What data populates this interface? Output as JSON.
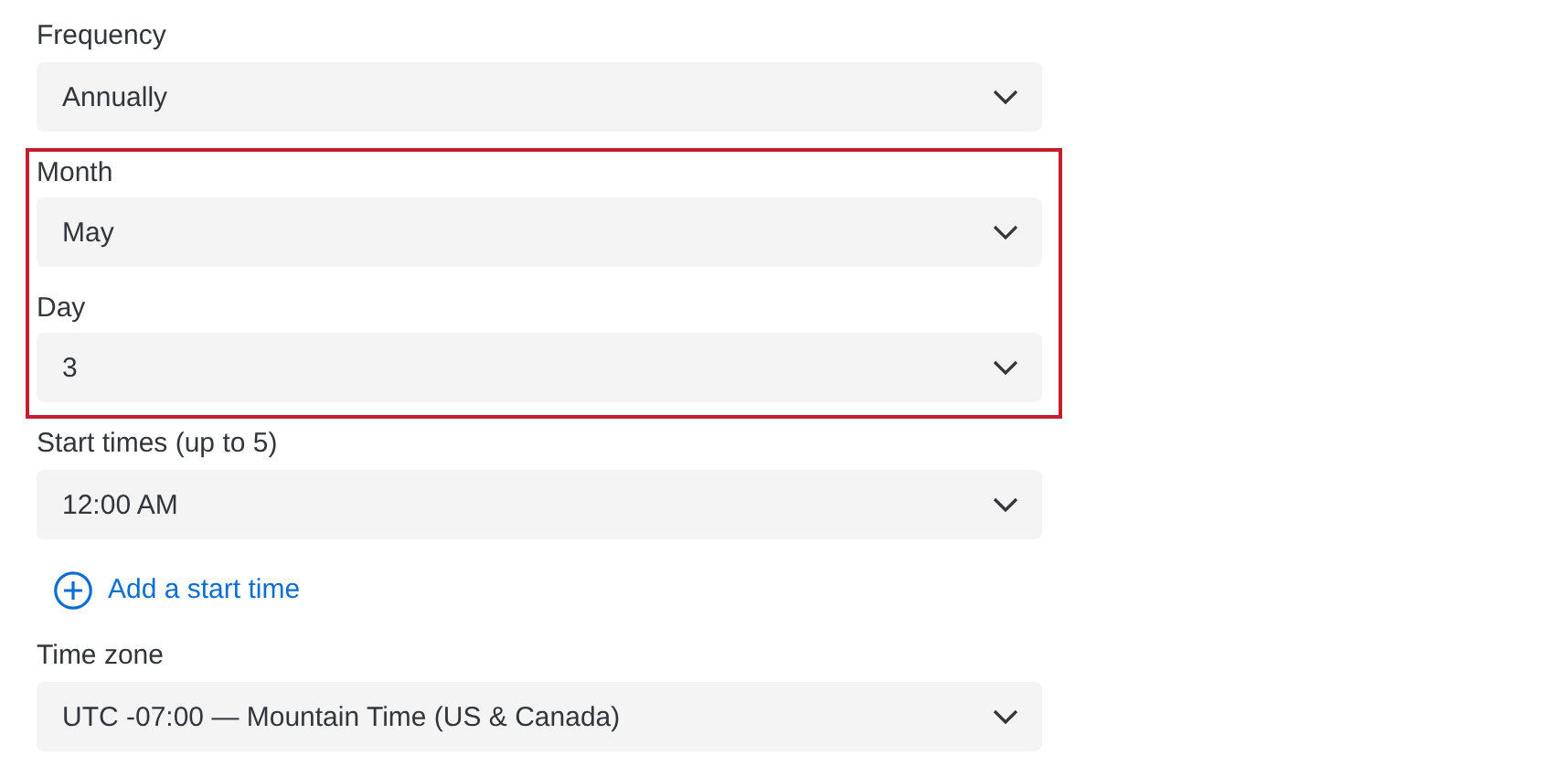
{
  "items": [
    {
      "kind": "field",
      "label": "Frequency",
      "value": "Annually"
    },
    {
      "kind": "highlight",
      "fields": [
        {
          "label": "Month",
          "value": "May"
        },
        {
          "label": "Day",
          "value": "3"
        }
      ]
    },
    {
      "kind": "field",
      "label": "Start times (up to 5)",
      "value": "12:00 AM"
    },
    {
      "kind": "link",
      "label": "Add a start time"
    },
    {
      "kind": "field",
      "label": "Time zone",
      "value": "UTC -07:00 — Mountain Time (US & Canada)"
    }
  ]
}
